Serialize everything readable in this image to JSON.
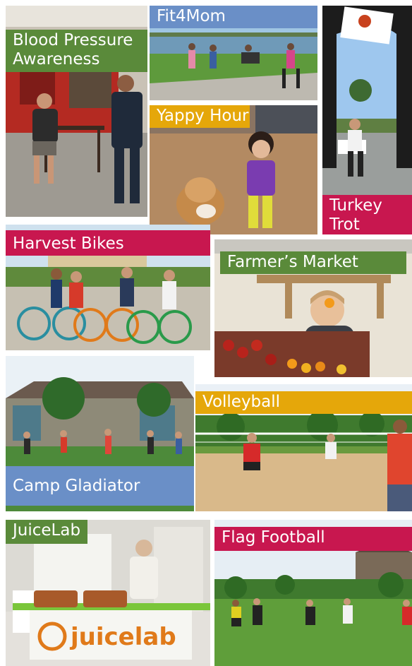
{
  "colors": {
    "green": "#5a8a3a",
    "blue": "#6a8fc7",
    "orange": "#e5a70a",
    "crimson": "#c8174f"
  },
  "tiles": [
    {
      "label": "Blood Pressure Awareness",
      "color": "green"
    },
    {
      "label": "Fit4Mom",
      "color": "blue"
    },
    {
      "label": "Yappy Hour",
      "color": "orange"
    },
    {
      "label": "Turkey Trot",
      "color": "crimson"
    },
    {
      "label": "Harvest Bikes",
      "color": "crimson"
    },
    {
      "label": "Farmer’s Market",
      "color": "green"
    },
    {
      "label": "Camp Gladiator",
      "color": "blue"
    },
    {
      "label": "Volleyball",
      "color": "orange"
    },
    {
      "label": "JuiceLab",
      "color": "green"
    },
    {
      "label": "Flag Football",
      "color": "crimson"
    }
  ],
  "juicelab_banner": {
    "text": "juicelab"
  }
}
